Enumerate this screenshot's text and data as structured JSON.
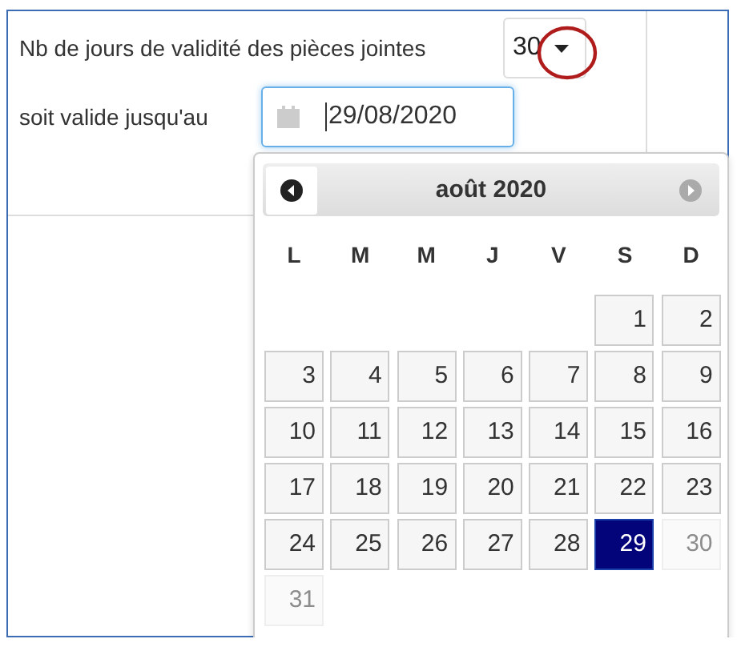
{
  "form": {
    "fields": [
      {
        "kind": "select",
        "label": "Nb de jours de validité des pièces jointes",
        "value": "30"
      },
      {
        "kind": "date",
        "label": "soit valide jusqu'au",
        "value": "29/08/2020",
        "focused": true
      }
    ]
  },
  "annotation": {
    "kind": "circle",
    "color": "#b01c1c"
  },
  "datepicker": {
    "title": "août 2020",
    "prev_disabled": false,
    "next_disabled": true,
    "weekdays": [
      "L",
      "M",
      "M",
      "J",
      "V",
      "S",
      "D"
    ],
    "weeks": [
      [
        {
          "kind": "blank"
        },
        {
          "kind": "blank"
        },
        {
          "kind": "blank"
        },
        {
          "kind": "blank"
        },
        {
          "kind": "blank"
        },
        {
          "kind": "day",
          "label": "1",
          "selected": false,
          "disabled": false
        },
        {
          "kind": "day",
          "label": "2",
          "selected": false,
          "disabled": false
        }
      ],
      [
        {
          "kind": "day",
          "label": "3",
          "selected": false,
          "disabled": false
        },
        {
          "kind": "day",
          "label": "4",
          "selected": false,
          "disabled": false
        },
        {
          "kind": "day",
          "label": "5",
          "selected": false,
          "disabled": false
        },
        {
          "kind": "day",
          "label": "6",
          "selected": false,
          "disabled": false
        },
        {
          "kind": "day",
          "label": "7",
          "selected": false,
          "disabled": false
        },
        {
          "kind": "day",
          "label": "8",
          "selected": false,
          "disabled": false
        },
        {
          "kind": "day",
          "label": "9",
          "selected": false,
          "disabled": false
        }
      ],
      [
        {
          "kind": "day",
          "label": "10",
          "selected": false,
          "disabled": false
        },
        {
          "kind": "day",
          "label": "11",
          "selected": false,
          "disabled": false
        },
        {
          "kind": "day",
          "label": "12",
          "selected": false,
          "disabled": false
        },
        {
          "kind": "day",
          "label": "13",
          "selected": false,
          "disabled": false
        },
        {
          "kind": "day",
          "label": "14",
          "selected": false,
          "disabled": false
        },
        {
          "kind": "day",
          "label": "15",
          "selected": false,
          "disabled": false
        },
        {
          "kind": "day",
          "label": "16",
          "selected": false,
          "disabled": false
        }
      ],
      [
        {
          "kind": "day",
          "label": "17",
          "selected": false,
          "disabled": false
        },
        {
          "kind": "day",
          "label": "18",
          "selected": false,
          "disabled": false
        },
        {
          "kind": "day",
          "label": "19",
          "selected": false,
          "disabled": false
        },
        {
          "kind": "day",
          "label": "20",
          "selected": false,
          "disabled": false
        },
        {
          "kind": "day",
          "label": "21",
          "selected": false,
          "disabled": false
        },
        {
          "kind": "day",
          "label": "22",
          "selected": false,
          "disabled": false
        },
        {
          "kind": "day",
          "label": "23",
          "selected": false,
          "disabled": false
        }
      ],
      [
        {
          "kind": "day",
          "label": "24",
          "selected": false,
          "disabled": false
        },
        {
          "kind": "day",
          "label": "25",
          "selected": false,
          "disabled": false
        },
        {
          "kind": "day",
          "label": "26",
          "selected": false,
          "disabled": false
        },
        {
          "kind": "day",
          "label": "27",
          "selected": false,
          "disabled": false
        },
        {
          "kind": "day",
          "label": "28",
          "selected": false,
          "disabled": false
        },
        {
          "kind": "day",
          "label": "29",
          "selected": true,
          "disabled": false
        },
        {
          "kind": "day",
          "label": "30",
          "selected": false,
          "disabled": true
        }
      ],
      [
        {
          "kind": "day",
          "label": "31",
          "selected": false,
          "disabled": true
        }
      ]
    ]
  }
}
